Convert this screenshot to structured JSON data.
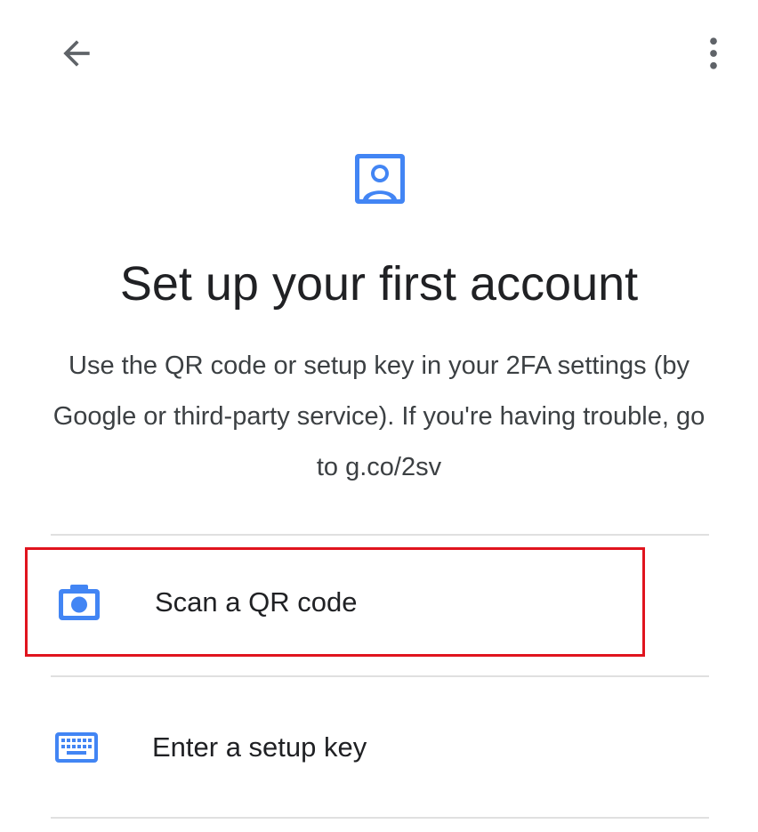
{
  "header": {
    "back_icon": "arrow-back-icon",
    "more_icon": "more-vert-icon"
  },
  "hero": {
    "icon": "account-box-icon",
    "title": "Set up your first account",
    "description": "Use the QR code or setup key in your 2FA settings (by Google or third-party service). If you're having trouble, go to g.co/2sv"
  },
  "options": [
    {
      "label": "Scan a QR code",
      "icon": "camera-icon"
    },
    {
      "label": "Enter a setup key",
      "icon": "keyboard-icon"
    }
  ],
  "colors": {
    "accent": "#4285f4",
    "highlight_border": "#e0141e",
    "icon_gray": "#5f6368",
    "divider": "#e0e0e0"
  }
}
